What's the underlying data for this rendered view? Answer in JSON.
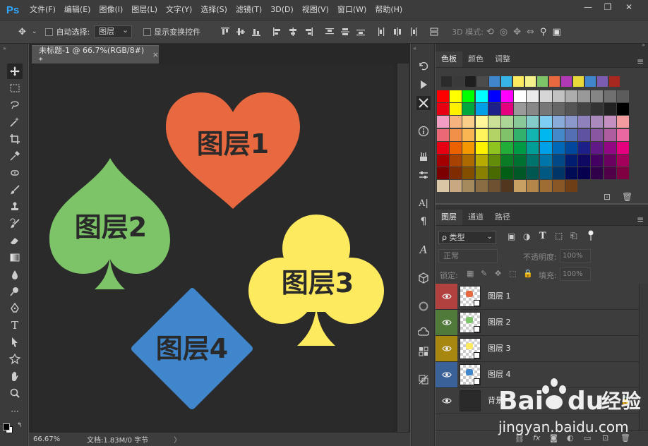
{
  "app": {
    "logo": "Ps"
  },
  "menu": [
    "文件(F)",
    "编辑(E)",
    "图像(I)",
    "图层(L)",
    "文字(Y)",
    "选择(S)",
    "滤镜(T)",
    "3D(D)",
    "视图(V)",
    "窗口(W)",
    "帮助(H)"
  ],
  "window_controls": {
    "minimize": "—",
    "restore": "❐",
    "close": "✕"
  },
  "options": {
    "auto_select_label": "自动选择:",
    "auto_select_value": "图层",
    "show_transform_label": "显示变换控件",
    "mode_3d_label": "3D 模式:"
  },
  "document": {
    "tab_title": "未标题-1 @ 66.7%(RGB/8#) *",
    "tab_close": "×",
    "zoom": "66.67%",
    "doc_info": "文档:1.83M/0 字节",
    "arrow": "〉"
  },
  "canvas_shapes": [
    {
      "name": "heart",
      "label": "图层1",
      "color": "#e8693f"
    },
    {
      "name": "spade",
      "label": "图层2",
      "color": "#7cc467"
    },
    {
      "name": "club",
      "label": "图层3",
      "color": "#fdea5e"
    },
    {
      "name": "diamond",
      "label": "图层4",
      "color": "#3f86cc"
    }
  ],
  "swatches_panel": {
    "tabs": [
      "色板",
      "颜色",
      "调整"
    ],
    "menu": "≡"
  },
  "layers_panel": {
    "tabs": [
      "图层",
      "通道",
      "路径"
    ],
    "filter_label": "ρ 类型",
    "blend_mode": "正常",
    "opacity_label": "不透明度:",
    "opacity_value": "100%",
    "lock_label": "锁定:",
    "fill_label": "填充:",
    "fill_value": "100%",
    "layers": [
      {
        "name": "图层 1",
        "eye_bg": "#b0413e",
        "thumb_color": "#e8693f"
      },
      {
        "name": "图层 2",
        "eye_bg": "#4f7a3a",
        "thumb_color": "#7cc467"
      },
      {
        "name": "图层 3",
        "eye_bg": "#a7870f",
        "thumb_color": "#fdea5e"
      },
      {
        "name": "图层 4",
        "eye_bg": "#3b6199",
        "thumb_color": "#3f86cc"
      },
      {
        "name": "背景",
        "eye_bg": "#3d3d3d",
        "thumb_color": "#2a2a2a"
      }
    ],
    "footer_icons": [
      "link-icon",
      "fx-icon",
      "mask-icon",
      "adjustment-icon",
      "folder-icon",
      "new-layer-icon",
      "trash-icon"
    ],
    "fx_label": "fx"
  },
  "watermark": {
    "brand": "Bai",
    "brand2": "du",
    "cn": "经验",
    "url": "jingyan.baidu.com"
  }
}
